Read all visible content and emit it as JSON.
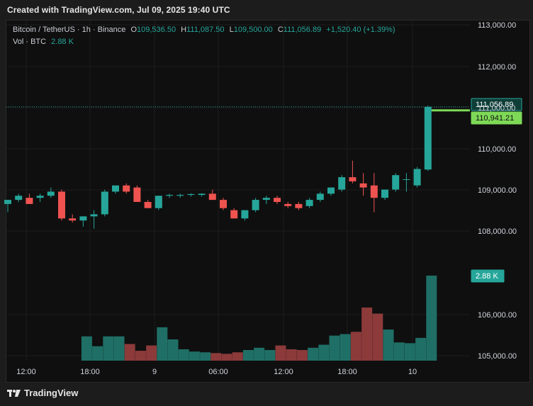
{
  "header": {
    "created_text": "Created with TradingView.com, Jul 09, 2025 19:40 UTC"
  },
  "legend": {
    "symbol": "Bitcoin / TetherUS · 1h · Binance",
    "o_label": "O",
    "o_value": "109,536.50",
    "h_label": "H",
    "h_value": "111,087.50",
    "l_label": "L",
    "l_value": "109,500.00",
    "c_label": "C",
    "c_value": "111,056.89",
    "change": "+1,520.40 (+1.39%)",
    "vol_label": "Vol · BTC",
    "vol_value": "2.88 K"
  },
  "footer": {
    "brand": "TradingView"
  },
  "price_tags": {
    "last_price": "111,056.89",
    "ma_price": "110,941.21",
    "volume": "2.88 K"
  },
  "colors": {
    "up": "#26a69a",
    "down": "#ef5350",
    "volume_up": "#1f6f66",
    "volume_down": "#8c3a3a",
    "ma_line": "#7ed957",
    "background": "#0f0f0f"
  },
  "chart_data": {
    "type": "candlestick",
    "y_ticks": [
      "113,000.00",
      "112,000.00",
      "111,000.00",
      "110,000.00",
      "109,000.00",
      "108,000.00",
      "106,000.00",
      "105,000.00"
    ],
    "x_ticks": [
      "12:00",
      "18:00",
      "9",
      "06:00",
      "12:00",
      "18:00",
      "10"
    ],
    "ylim": [
      104900,
      113150
    ],
    "candles": [
      {
        "o": 108700,
        "h": 108800,
        "l": 108500,
        "c": 108800
      },
      {
        "o": 108800,
        "h": 108950,
        "l": 108750,
        "c": 108900
      },
      {
        "o": 108850,
        "h": 108950,
        "l": 108700,
        "c": 108700
      },
      {
        "o": 108850,
        "h": 108950,
        "l": 108750,
        "c": 108900
      },
      {
        "o": 108900,
        "h": 109100,
        "l": 108850,
        "c": 109000
      },
      {
        "o": 109000,
        "h": 109050,
        "l": 108300,
        "c": 108350
      },
      {
        "o": 108350,
        "h": 108450,
        "l": 108250,
        "c": 108300
      },
      {
        "o": 108300,
        "h": 108400,
        "l": 108150,
        "c": 108400
      },
      {
        "o": 108400,
        "h": 108550,
        "l": 108100,
        "c": 108450
      },
      {
        "o": 108450,
        "h": 109050,
        "l": 108400,
        "c": 109000
      },
      {
        "o": 109000,
        "h": 109150,
        "l": 108950,
        "c": 109150
      },
      {
        "o": 109150,
        "h": 109200,
        "l": 108950,
        "c": 109000
      },
      {
        "o": 109100,
        "h": 109150,
        "l": 108750,
        "c": 108750
      },
      {
        "o": 108750,
        "h": 108800,
        "l": 108600,
        "c": 108600
      },
      {
        "o": 108600,
        "h": 108900,
        "l": 108550,
        "c": 108900
      },
      {
        "o": 108900,
        "h": 108950,
        "l": 108850,
        "c": 108920
      },
      {
        "o": 108900,
        "h": 108950,
        "l": 108850,
        "c": 108920
      },
      {
        "o": 108920,
        "h": 108960,
        "l": 108880,
        "c": 108940
      },
      {
        "o": 108920,
        "h": 108960,
        "l": 108880,
        "c": 108950
      },
      {
        "o": 108950,
        "h": 109050,
        "l": 108800,
        "c": 108800
      },
      {
        "o": 108800,
        "h": 108850,
        "l": 108550,
        "c": 108600
      },
      {
        "o": 108550,
        "h": 108600,
        "l": 108350,
        "c": 108350
      },
      {
        "o": 108350,
        "h": 108550,
        "l": 108300,
        "c": 108550
      },
      {
        "o": 108550,
        "h": 108850,
        "l": 108500,
        "c": 108800
      },
      {
        "o": 108800,
        "h": 108900,
        "l": 108700,
        "c": 108850
      },
      {
        "o": 108850,
        "h": 108900,
        "l": 108700,
        "c": 108750
      },
      {
        "o": 108700,
        "h": 108750,
        "l": 108600,
        "c": 108650
      },
      {
        "o": 108700,
        "h": 108750,
        "l": 108550,
        "c": 108600
      },
      {
        "o": 108650,
        "h": 108850,
        "l": 108600,
        "c": 108800
      },
      {
        "o": 108800,
        "h": 109000,
        "l": 108750,
        "c": 108950
      },
      {
        "o": 108950,
        "h": 109100,
        "l": 108900,
        "c": 109100
      },
      {
        "o": 109050,
        "h": 109400,
        "l": 109000,
        "c": 109350
      },
      {
        "o": 109350,
        "h": 109750,
        "l": 109200,
        "c": 109250
      },
      {
        "o": 109200,
        "h": 109450,
        "l": 108900,
        "c": 109100
      },
      {
        "o": 109150,
        "h": 109450,
        "l": 108500,
        "c": 108850
      },
      {
        "o": 108850,
        "h": 109050,
        "l": 108800,
        "c": 109050
      },
      {
        "o": 109050,
        "h": 109450,
        "l": 109000,
        "c": 109400
      },
      {
        "o": 109300,
        "h": 109450,
        "l": 109000,
        "c": 109300
      },
      {
        "o": 109150,
        "h": 109600,
        "l": 109100,
        "c": 109550
      },
      {
        "o": 109536.5,
        "h": 111087.5,
        "l": 109500,
        "c": 111056.89
      }
    ],
    "volumes": [
      320,
      190,
      320,
      320,
      220,
      130,
      200,
      440,
      280,
      150,
      120,
      110,
      100,
      90,
      110,
      140,
      170,
      140,
      200,
      150,
      140,
      170,
      210,
      330,
      350,
      380,
      700,
      620,
      410,
      240,
      230,
      300,
      1120
    ],
    "volume_max_value": 2880,
    "volume_last": "2.88 K"
  }
}
